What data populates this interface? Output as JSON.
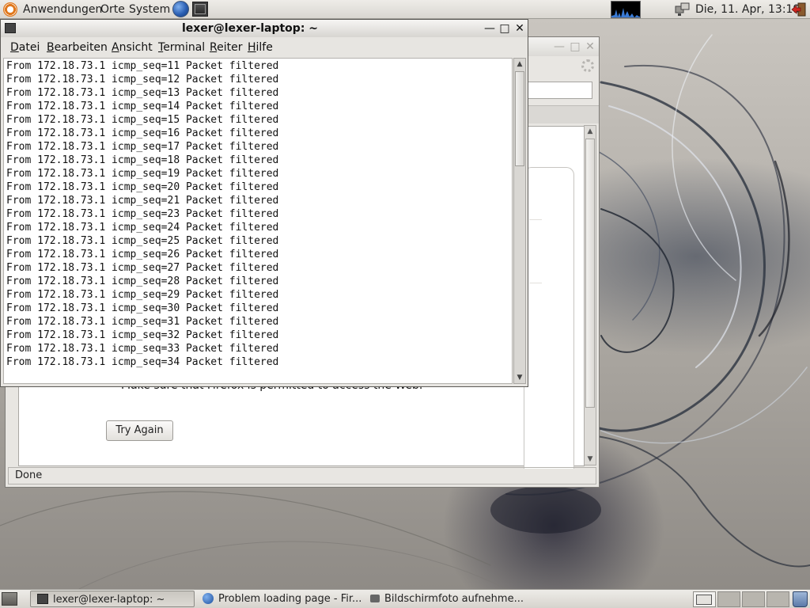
{
  "top_panel": {
    "menus": [
      "Anwendungen",
      "Orte",
      "System"
    ],
    "clock": "Die, 11. Apr, 13:19"
  },
  "terminal": {
    "title": "lexer@lexer-laptop: ~",
    "menu": [
      "Datei",
      "Bearbeiten",
      "Ansicht",
      "Terminal",
      "Reiter",
      "Hilfe"
    ],
    "lines": [
      "From 172.18.73.1 icmp_seq=11 Packet filtered",
      "From 172.18.73.1 icmp_seq=12 Packet filtered",
      "From 172.18.73.1 icmp_seq=13 Packet filtered",
      "From 172.18.73.1 icmp_seq=14 Packet filtered",
      "From 172.18.73.1 icmp_seq=15 Packet filtered",
      "From 172.18.73.1 icmp_seq=16 Packet filtered",
      "From 172.18.73.1 icmp_seq=17 Packet filtered",
      "From 172.18.73.1 icmp_seq=18 Packet filtered",
      "From 172.18.73.1 icmp_seq=19 Packet filtered",
      "From 172.18.73.1 icmp_seq=20 Packet filtered",
      "From 172.18.73.1 icmp_seq=21 Packet filtered",
      "From 172.18.73.1 icmp_seq=23 Packet filtered",
      "From 172.18.73.1 icmp_seq=24 Packet filtered",
      "From 172.18.73.1 icmp_seq=25 Packet filtered",
      "From 172.18.73.1 icmp_seq=26 Packet filtered",
      "From 172.18.73.1 icmp_seq=27 Packet filtered",
      "From 172.18.73.1 icmp_seq=28 Packet filtered",
      "From 172.18.73.1 icmp_seq=29 Packet filtered",
      "From 172.18.73.1 icmp_seq=30 Packet filtered",
      "From 172.18.73.1 icmp_seq=31 Packet filtered",
      "From 172.18.73.1 icmp_seq=32 Packet filtered",
      "From 172.18.73.1 icmp_seq=33 Packet filtered",
      "From 172.18.73.1 icmp_seq=34 Packet filtered"
    ]
  },
  "firefox": {
    "error_text": "Make sure that Firefox is permitted to access the Web.",
    "try_again": "Try Again",
    "status": "Done"
  },
  "taskbar": {
    "tasks": [
      {
        "label": "lexer@lexer-laptop: ~",
        "icon": "terminal-icon"
      },
      {
        "label": "Problem loading page - Fir...",
        "icon": "firefox-icon"
      },
      {
        "label": "Bildschirmfoto aufnehme...",
        "icon": "camera-icon"
      }
    ]
  },
  "colors": {
    "ubuntu_orange": "#e0781d",
    "panel": "#e4e2de"
  }
}
